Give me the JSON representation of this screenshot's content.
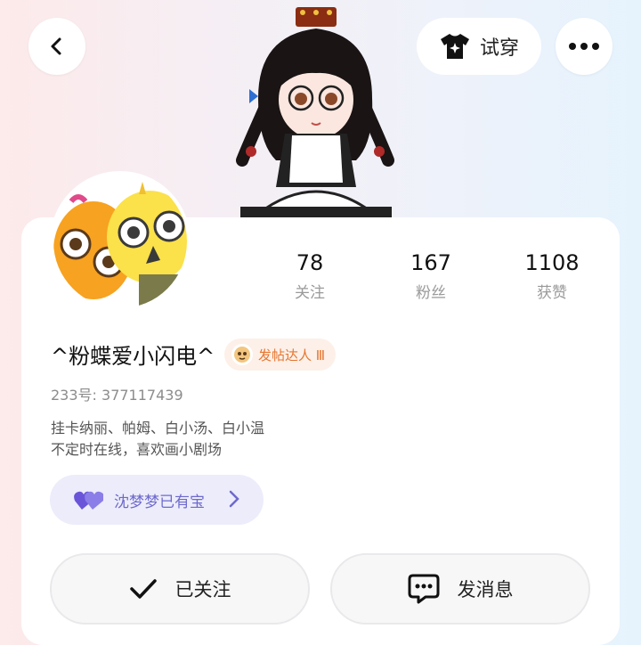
{
  "header": {
    "tryon_label": "试穿"
  },
  "stats": [
    {
      "value": "78",
      "label": "关注"
    },
    {
      "value": "167",
      "label": "粉丝"
    },
    {
      "value": "1108",
      "label": "获赞"
    }
  ],
  "profile": {
    "nickname": "^粉蝶爱小闪电^",
    "badge_label": "发帖达人 Ⅲ",
    "uid": "233号: 377117439",
    "bio_line1": "挂卡纳丽、帕姆、白小汤、白小温",
    "bio_line2": "不定时在线，喜欢画小剧场",
    "cp_label": "沈梦梦已有宝"
  },
  "actions": {
    "follow_label": "已关注",
    "message_label": "发消息"
  },
  "colors": {
    "badge_text": "#e6752f",
    "cp_text": "#6e6acc",
    "cp_bg": "#ececfb"
  }
}
